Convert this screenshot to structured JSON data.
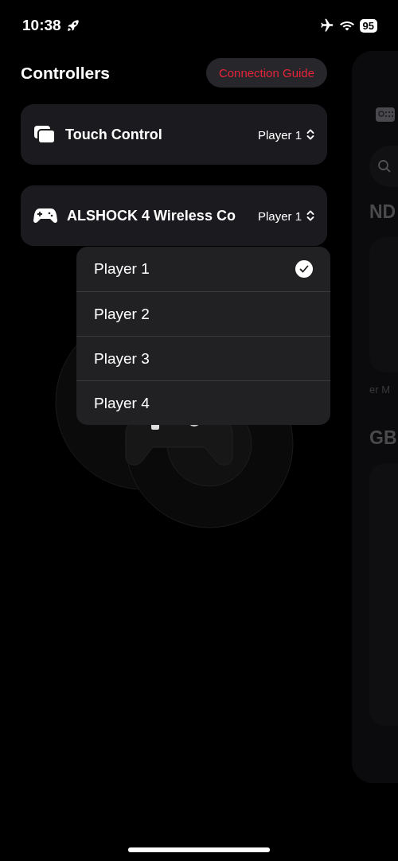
{
  "status_bar": {
    "time": "10:38",
    "battery": "95"
  },
  "header": {
    "title": "Controllers",
    "guide_button": "Connection Guide"
  },
  "controllers": [
    {
      "kind": "touch",
      "name": "Touch Control",
      "player": "Player 1"
    },
    {
      "kind": "gamepad",
      "name": "ALSHOCK 4 Wireless Co",
      "player": "Player 1"
    }
  ],
  "player_menu": {
    "items": [
      {
        "label": "Player 1",
        "selected": true
      },
      {
        "label": "Player 2",
        "selected": false
      },
      {
        "label": "Player 3",
        "selected": false
      },
      {
        "label": "Player 4",
        "selected": false
      }
    ]
  },
  "side_panel": {
    "heading_1": "ND",
    "caption": "er M",
    "heading_2": "GB"
  }
}
